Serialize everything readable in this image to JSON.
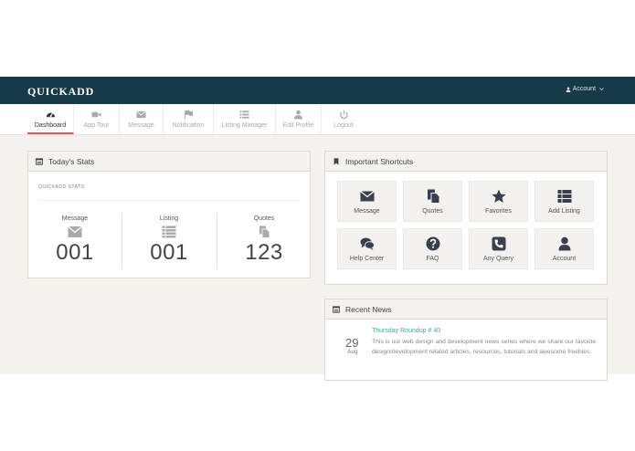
{
  "app": {
    "brand": "QUICKADD",
    "account_label": "Account"
  },
  "tabs": [
    {
      "label": "Dashboard",
      "icon": "dashboard-icon",
      "active": true
    },
    {
      "label": "App Tour",
      "icon": "video-camera-icon"
    },
    {
      "label": "Message",
      "icon": "envelope-icon"
    },
    {
      "label": "Notification",
      "icon": "flag-icon"
    },
    {
      "label": "Listing Manager",
      "icon": "list-icon"
    },
    {
      "label": "Edit Profile",
      "icon": "user-icon"
    },
    {
      "label": "Logout",
      "icon": "power-icon"
    }
  ],
  "stats_panel": {
    "title": "Today's Stats",
    "subtitle": "QUICKADD STATS",
    "items": [
      {
        "label": "Message",
        "value": "001",
        "icon": "envelope-icon"
      },
      {
        "label": "Listing",
        "value": "001",
        "icon": "list-icon"
      },
      {
        "label": "Quotes",
        "value": "123",
        "icon": "copy-icon"
      }
    ]
  },
  "shortcuts_panel": {
    "title": "Important Shortcuts",
    "items": [
      {
        "label": "Message",
        "icon": "envelope-icon"
      },
      {
        "label": "Quotes",
        "icon": "copy-icon"
      },
      {
        "label": "Favorites",
        "icon": "star-icon"
      },
      {
        "label": "Add Listing",
        "icon": "th-list-icon"
      },
      {
        "label": "Help Center",
        "icon": "comments-icon"
      },
      {
        "label": "FAQ",
        "icon": "question-circle-icon"
      },
      {
        "label": "Any Query",
        "icon": "phone-icon"
      },
      {
        "label": "Account",
        "icon": "user-icon"
      }
    ]
  },
  "news_panel": {
    "title": "Recent News",
    "items": [
      {
        "day": "29",
        "month": "Aug",
        "title": "Thursday Roundup # 40",
        "body": "This is our web design and development news series where we share our favorite design/development related articles, resources, tutorials and awesome freebies."
      }
    ]
  },
  "colors": {
    "topbar": "#163a48",
    "active_tab_underline": "#e05b5b",
    "link": "#26b0a0",
    "content_bg": "#f4f2ee"
  }
}
